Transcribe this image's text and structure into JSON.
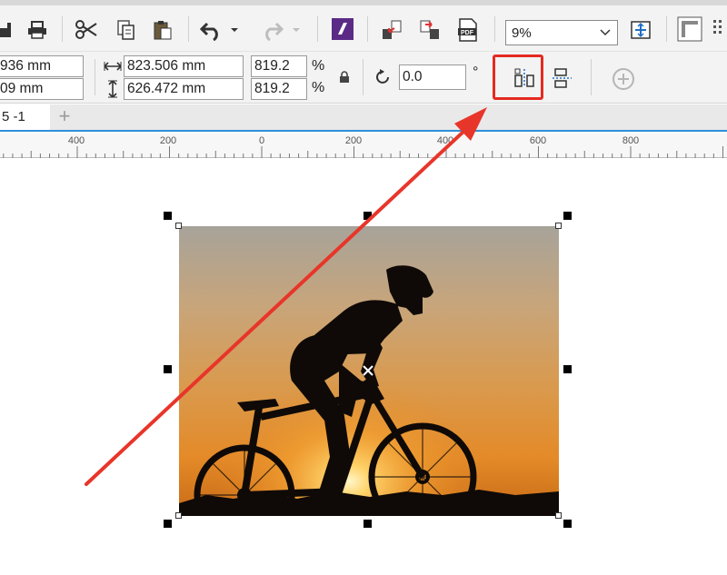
{
  "toolbar": {
    "zoom_value": "9%",
    "icons": [
      "save-icon",
      "print-icon",
      "cut-icon",
      "copy-icon",
      "paste-icon",
      "undo-icon",
      "undo-dropdown-icon",
      "redo-icon",
      "redo-dropdown-icon",
      "app-launcher-icon",
      "import-icon",
      "export-icon",
      "publish-pdf-icon",
      "zoom-dropdown-icon",
      "full-screen-icon",
      "rulers-icon",
      "grid-icon"
    ]
  },
  "property_bar": {
    "x_value": "936 mm",
    "y_value": "09 mm",
    "width_value": "823.506 mm",
    "height_value": "626.472 mm",
    "scale_x": "819.2",
    "scale_y": "819.2",
    "percent_symbol": "%",
    "rotation_value": "0.0",
    "degree_symbol": "°"
  },
  "document": {
    "tab_label": "5 -1",
    "add_tab_symbol": "+"
  },
  "ruler": {
    "labels": [
      "400",
      "200",
      "0",
      "200",
      "400",
      "600",
      "800"
    ]
  },
  "annotation": {
    "highlight_color": "#e52a21",
    "arrow_color": "#e8352a"
  }
}
